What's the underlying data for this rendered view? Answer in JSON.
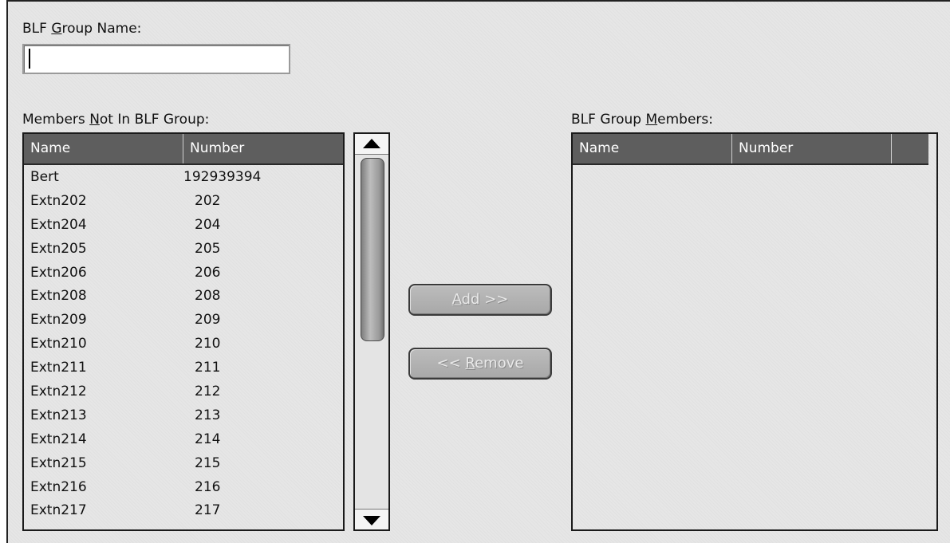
{
  "group_name": {
    "label_pre": "BLF ",
    "label_key": "G",
    "label_post": "roup Name:",
    "value": ""
  },
  "available": {
    "label_pre": "Members ",
    "label_key": "N",
    "label_post": "ot In BLF Group:",
    "columns": [
      "Name",
      "Number"
    ],
    "rows": [
      {
        "name": "Bert",
        "number": "192939394"
      },
      {
        "name": "Extn202",
        "number": "202"
      },
      {
        "name": "Extn204",
        "number": "204"
      },
      {
        "name": "Extn205",
        "number": "205"
      },
      {
        "name": "Extn206",
        "number": "206"
      },
      {
        "name": "Extn208",
        "number": "208"
      },
      {
        "name": "Extn209",
        "number": "209"
      },
      {
        "name": "Extn210",
        "number": "210"
      },
      {
        "name": "Extn211",
        "number": "211"
      },
      {
        "name": "Extn212",
        "number": "212"
      },
      {
        "name": "Extn213",
        "number": "213"
      },
      {
        "name": "Extn214",
        "number": "214"
      },
      {
        "name": "Extn215",
        "number": "215"
      },
      {
        "name": "Extn216",
        "number": "216"
      },
      {
        "name": "Extn217",
        "number": "217"
      }
    ]
  },
  "members": {
    "label_pre": "BLF Group ",
    "label_key": "M",
    "label_post": "embers:",
    "columns": [
      "Name",
      "Number"
    ]
  },
  "buttons": {
    "add_key": "A",
    "add_rest": "dd  >>",
    "remove_pre": "<<  ",
    "remove_key": "R",
    "remove_rest": "emove"
  },
  "icons": {
    "scroll_up": "triangle-up",
    "scroll_down": "triangle-down"
  }
}
